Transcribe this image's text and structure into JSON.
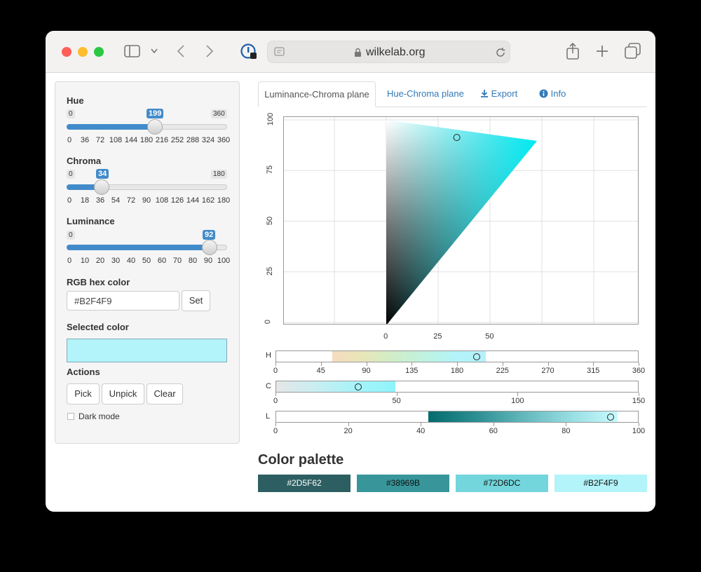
{
  "browser": {
    "url": "wilkelab.org"
  },
  "sidebar": {
    "hue": {
      "label": "Hue",
      "min": "0",
      "max": "360",
      "value": "199",
      "ticks": [
        "0",
        "36",
        "72",
        "108",
        "144",
        "180",
        "216",
        "252",
        "288",
        "324",
        "360"
      ]
    },
    "chroma": {
      "label": "Chroma",
      "min": "0",
      "max": "180",
      "value": "34",
      "ticks": [
        "0",
        "18",
        "36",
        "54",
        "72",
        "90",
        "108",
        "126",
        "144",
        "162",
        "180"
      ]
    },
    "luminance": {
      "label": "Luminance",
      "min": "0",
      "max": "100",
      "value": "92",
      "ticks": [
        "0",
        "10",
        "20",
        "30",
        "40",
        "50",
        "60",
        "70",
        "80",
        "90",
        "100"
      ]
    },
    "hex": {
      "label": "RGB hex color",
      "value": "#B2F4F9",
      "set_label": "Set"
    },
    "selected": {
      "label": "Selected color",
      "color": "#B2F4F9"
    },
    "actions": {
      "label": "Actions",
      "pick": "Pick",
      "unpick": "Unpick",
      "clear": "Clear"
    },
    "dark_mode": "Dark mode"
  },
  "tabs": {
    "lc": "Luminance-Chroma plane",
    "hc": "Hue-Chroma plane",
    "export": "Export",
    "info": "Info"
  },
  "chart_data": {
    "type": "scatter",
    "y_ticks": [
      "0",
      "25",
      "50",
      "75",
      "100"
    ],
    "x_ticks": [
      "0",
      "25",
      "50"
    ],
    "point": {
      "chroma": 34,
      "luminance": 92
    },
    "strips": {
      "H": {
        "label": "H",
        "ticks": [
          "0",
          "45",
          "90",
          "135",
          "180",
          "225",
          "270",
          "315",
          "360"
        ],
        "value": 199
      },
      "C": {
        "label": "C",
        "ticks": [
          "0",
          "50",
          "100",
          "150"
        ],
        "value": 34
      },
      "L": {
        "label": "L",
        "ticks": [
          "0",
          "20",
          "40",
          "60",
          "80",
          "100"
        ],
        "value": 92
      }
    }
  },
  "palette": {
    "title": "Color palette",
    "colors": [
      {
        "hex": "#2D5F62",
        "label": "#2D5F62"
      },
      {
        "hex": "#38969B",
        "label": "#38969B"
      },
      {
        "hex": "#72D6DC",
        "label": "#72D6DC"
      },
      {
        "hex": "#B2F4F9",
        "label": "#B2F4F9"
      }
    ]
  }
}
